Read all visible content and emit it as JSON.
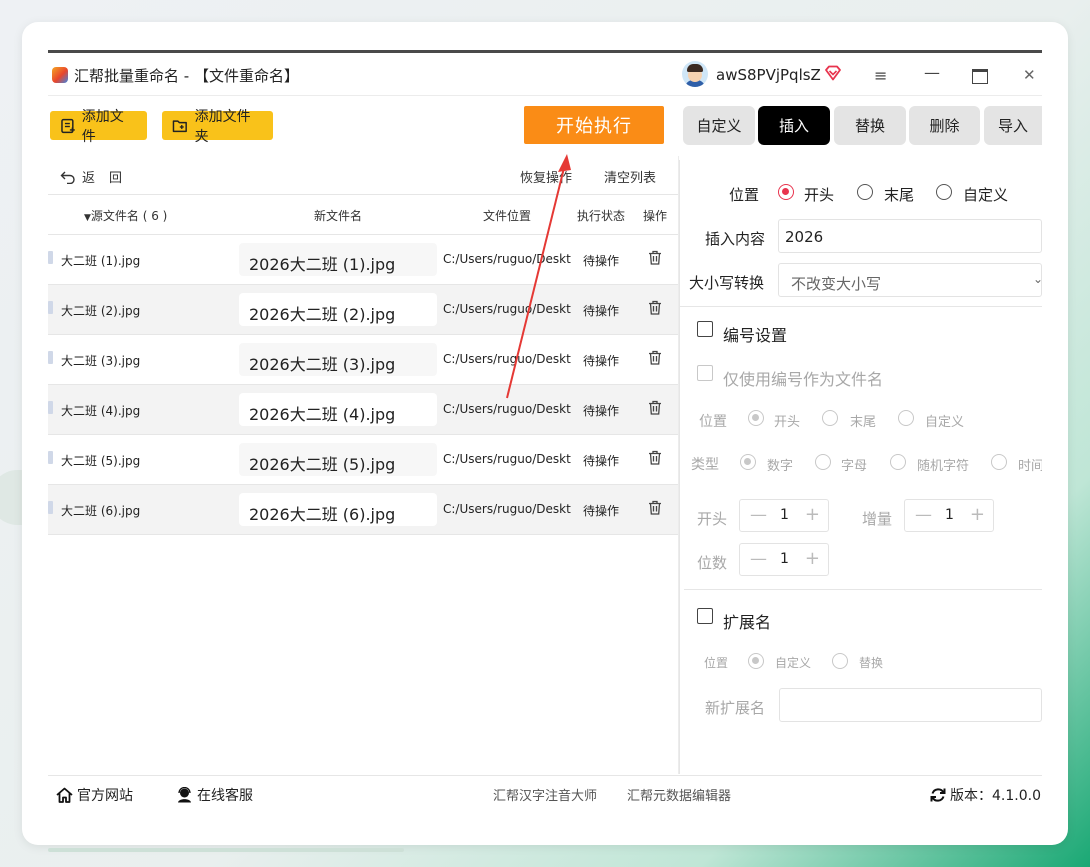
{
  "app": {
    "title": "汇帮批量重命名 - 【文件重命名】",
    "username": "awS8PVjPqlsZ"
  },
  "toolbar": {
    "add_file": "添加文件",
    "add_folder": "添加文件夹",
    "start": "开始执行"
  },
  "tabs": [
    {
      "label": "自定义",
      "active": false
    },
    {
      "label": "插入",
      "active": true
    },
    {
      "label": "替换",
      "active": false
    },
    {
      "label": "删除",
      "active": false
    },
    {
      "label": "导入",
      "active": false
    }
  ],
  "list": {
    "back": "返回",
    "restore": "恢复操作",
    "clear": "清空列表",
    "columns": {
      "source": "源文件名 ( 6 )",
      "new_name": "新文件名",
      "location": "文件位置",
      "status": "执行状态",
      "action": "操作"
    },
    "rows": [
      {
        "source": "大二班 (1).jpg",
        "new_name": "2026大二班 (1).jpg",
        "location": "C:/Users/ruguo/Desktop",
        "status": "待操作"
      },
      {
        "source": "大二班 (2).jpg",
        "new_name": "2026大二班 (2).jpg",
        "location": "C:/Users/ruguo/Desktop",
        "status": "待操作"
      },
      {
        "source": "大二班 (3).jpg",
        "new_name": "2026大二班 (3).jpg",
        "location": "C:/Users/ruguo/Desktop",
        "status": "待操作"
      },
      {
        "source": "大二班 (4).jpg",
        "new_name": "2026大二班 (4).jpg",
        "location": "C:/Users/ruguo/Desktop",
        "status": "待操作"
      },
      {
        "source": "大二班 (5).jpg",
        "new_name": "2026大二班 (5).jpg",
        "location": "C:/Users/ruguo/Desktop",
        "status": "待操作"
      },
      {
        "source": "大二班 (6).jpg",
        "new_name": "2026大二班 (6).jpg",
        "location": "C:/Users/ruguo/Desktop",
        "status": "待操作"
      }
    ]
  },
  "settings": {
    "position_label": "位置",
    "position_options": [
      "开头",
      "末尾",
      "自定义"
    ],
    "position_selected": "开头",
    "insert_label": "插入内容",
    "insert_value": "2026",
    "case_label": "大小写转换",
    "case_value": "不改变大小写",
    "numbering": {
      "label": "编号设置",
      "only_number_label": "仅使用编号作为文件名",
      "position_label": "位置",
      "position_options": [
        "开头",
        "末尾",
        "自定义"
      ],
      "type_label": "类型",
      "type_options": [
        "数字",
        "字母",
        "随机字符",
        "时间"
      ],
      "start_label": "开头",
      "start_value": "1",
      "step_label": "增量",
      "step_value": "1",
      "digits_label": "位数",
      "digits_value": "1"
    },
    "extension": {
      "label": "扩展名",
      "position_label": "位置",
      "options": [
        "自定义",
        "替换"
      ],
      "new_ext_label": "新扩展名",
      "new_ext_value": ""
    }
  },
  "footer": {
    "website": "官方网站",
    "support": "在线客服",
    "link1": "汇帮汉字注音大师",
    "link2": "汇帮元数据编辑器",
    "version": "版本：4.1.0.0"
  },
  "colors": {
    "accent_yellow": "#f9c21a",
    "start_orange": "#fa8c16",
    "radio_red": "#e8344e",
    "tab_active": "#000000"
  }
}
